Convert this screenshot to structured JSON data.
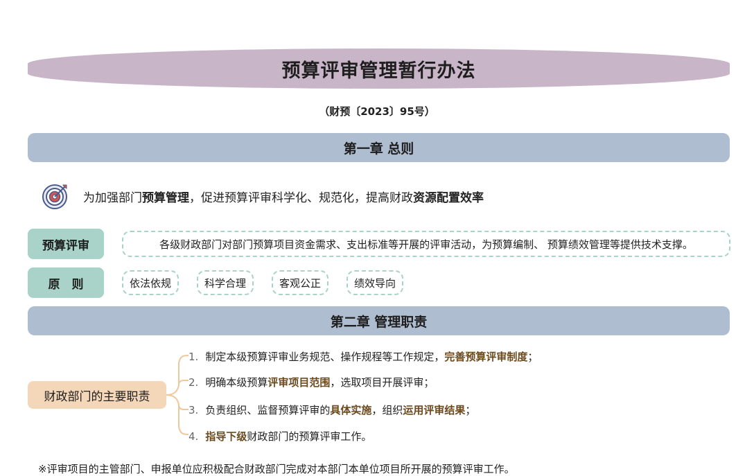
{
  "document": {
    "title": "预算评审管理暂行办法",
    "doc_number": "（财预〔2023〕95号）"
  },
  "chapter1": {
    "heading": "第一章 总则",
    "intro_parts": [
      {
        "text": "为加强部门",
        "bold": false
      },
      {
        "text": "预算管理",
        "bold": true
      },
      {
        "text": "，促进预算评审科学化、规范化，提高财政",
        "bold": false
      },
      {
        "text": "资源配置效率",
        "bold": true
      }
    ],
    "definition": {
      "label": "预算评审",
      "text": "各级财政部门对部门预算项目资金需求、支出标准等开展的评审活动，为预算编制、 预算绩效管理等提供技术支撑。"
    },
    "principles": {
      "label": "原　则",
      "items": [
        "依法依规",
        "科学合理",
        "客观公正",
        "绩效导向"
      ]
    }
  },
  "chapter2": {
    "heading": "第二章 管理职责",
    "duty_label": "财政部门的主要职责",
    "duties": [
      {
        "num": "1.",
        "parts": [
          {
            "text": "制定本级预算评审业务规范、操作规程等工作规定，",
            "bold": false
          },
          {
            "text": "完善预算评审制度",
            "bold": true
          },
          {
            "text": "；",
            "bold": false
          }
        ]
      },
      {
        "num": "2.",
        "parts": [
          {
            "text": "明确本级预算",
            "bold": false
          },
          {
            "text": "评审项目范围",
            "bold": true
          },
          {
            "text": "，选取项目开展评审；",
            "bold": false
          }
        ]
      },
      {
        "num": "3.",
        "parts": [
          {
            "text": "负责组织、监督预算评审的",
            "bold": false
          },
          {
            "text": "具体实施",
            "bold": true
          },
          {
            "text": "，组织",
            "bold": false
          },
          {
            "text": "运用评审结果",
            "bold": true
          },
          {
            "text": "；",
            "bold": false
          }
        ]
      },
      {
        "num": "4.",
        "parts": [
          {
            "text": "指导下级",
            "bold": true
          },
          {
            "text": "财政部门的预算评审工作。",
            "bold": false
          }
        ]
      }
    ]
  },
  "footnote": "※评审项目的主管部门、申报单位应积极配合财政部门完成对本部门本单位项目所开展的预算评审工作。",
  "colors": {
    "title_banner": "#c9b5c8",
    "chapter_bar": "#afbdd0",
    "teal_tag": "#a9d3c8",
    "duty_tag": "#f4d7b9",
    "duty_bold": "#6b4a1f"
  },
  "icons": {
    "intro": "target-icon"
  }
}
